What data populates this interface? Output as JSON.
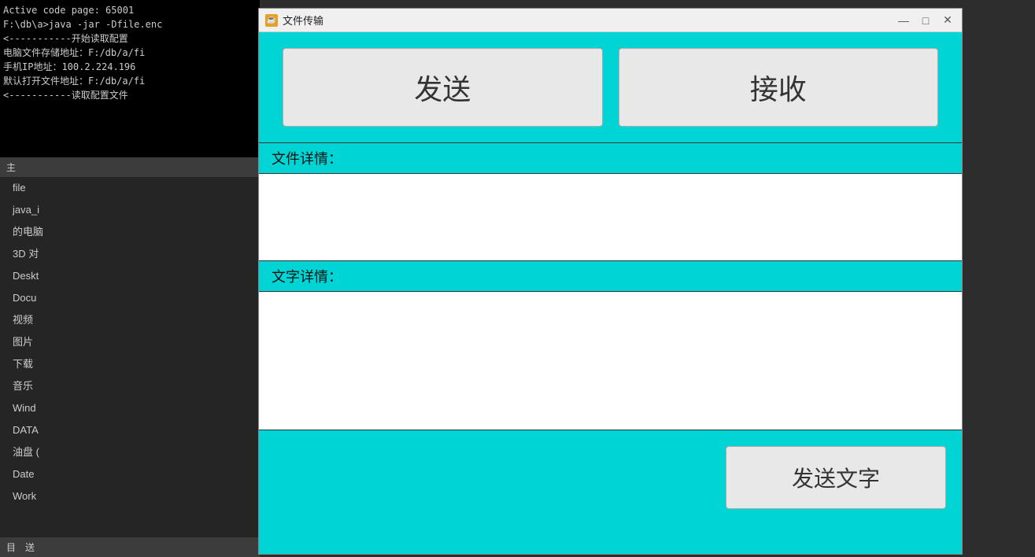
{
  "left_panel": {
    "terminal": {
      "lines": [
        "Active code page: 65001",
        "F:\\db\\a>java -jar -Dfile.enc",
        "<-----------开始读取配置",
        "电脑文件存储地址：F:/db/a/fi",
        "手机IP地址：100.2.224.196",
        "默认打开文件地址：F:/db/a/fi",
        "<-----------读取配置文件"
      ]
    },
    "header_label": "主",
    "file_items": [
      {
        "label": "file",
        "indent": 0
      },
      {
        "label": "java_i",
        "indent": 0
      },
      {
        "label": "的电脑",
        "indent": 0
      },
      {
        "label": "3D 对",
        "indent": 0
      },
      {
        "label": "Deskt",
        "indent": 0
      },
      {
        "label": "Docu",
        "indent": 0
      },
      {
        "label": "视频",
        "indent": 0
      },
      {
        "label": "图片",
        "indent": 0
      },
      {
        "label": "下载",
        "indent": 0
      },
      {
        "label": "音乐",
        "indent": 0
      },
      {
        "label": "Wind",
        "indent": 0
      },
      {
        "label": "DATA",
        "indent": 0
      },
      {
        "label": "油盘 (",
        "indent": 0
      },
      {
        "label": "Date",
        "indent": 0
      },
      {
        "label": "Work",
        "indent": 0
      }
    ],
    "bottom_tabs": [
      "目",
      "送"
    ]
  },
  "window": {
    "title": "文件传输",
    "icon_label": "☕",
    "controls": {
      "minimize": "—",
      "maximize": "□",
      "close": "✕"
    },
    "send_button_label": "发送",
    "receive_button_label": "接收",
    "file_details_label": "文件详情：",
    "text_details_label": "文字详情：",
    "send_text_button_label": "发送文字"
  }
}
